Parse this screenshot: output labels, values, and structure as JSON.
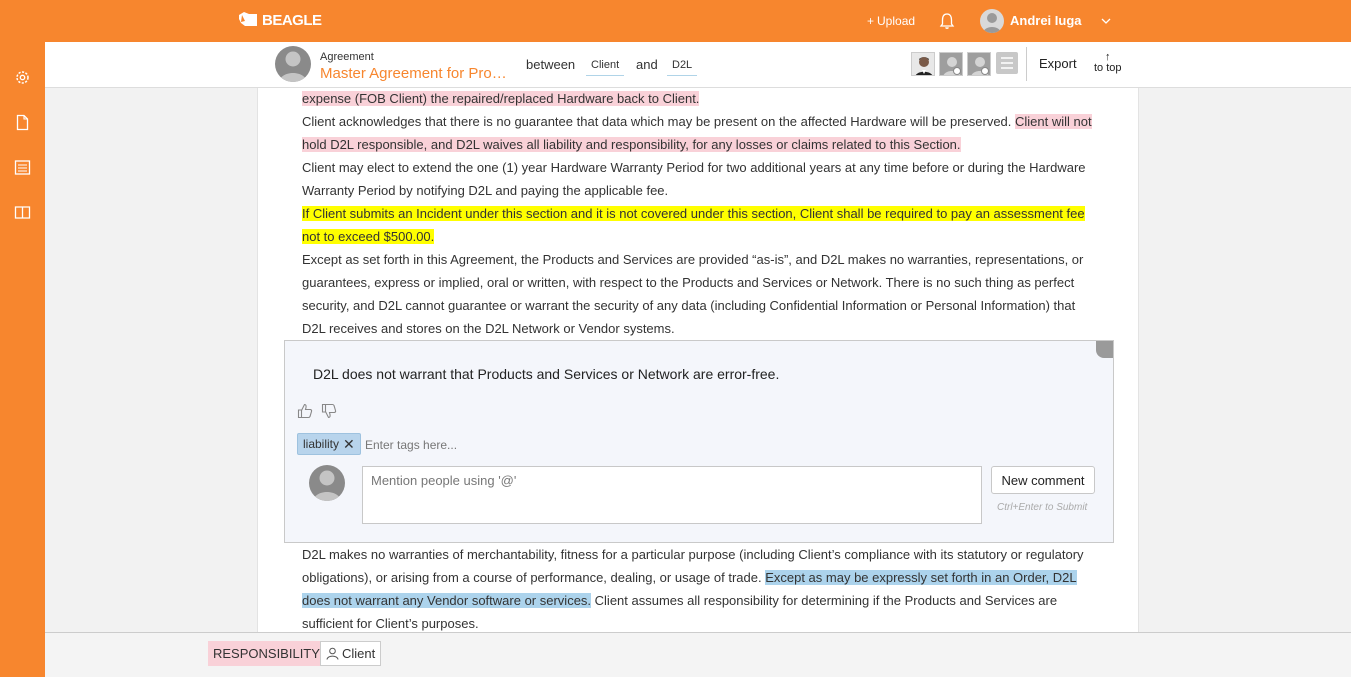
{
  "app": {
    "name": "BEAGLE"
  },
  "topbar": {
    "upload_label": "Upload",
    "user_name": "Andrei Iuga",
    "icons": [
      "plus-icon",
      "bell-icon",
      "avatar",
      "caret-down-icon"
    ]
  },
  "sidebar": {
    "items": [
      {
        "icon": "gear-icon"
      },
      {
        "icon": "document-icon"
      },
      {
        "icon": "list-icon"
      },
      {
        "icon": "book-icon"
      }
    ]
  },
  "header": {
    "doc_type": "Agreement",
    "doc_title": "Master Agreement for Products and Services",
    "between_label": "between",
    "party_a": "Client",
    "and_label": "and",
    "party_b": "D2L",
    "export_label": "Export",
    "to_top_label": "to top",
    "to_top_arrow": "↑"
  },
  "document": {
    "p1": {
      "highlight": "expense (FOB Client) the repaired/replaced Hardware back to Client."
    },
    "p2": {
      "text": " Client acknowledges that there is no guarantee that data which may be present on the affected Hardware will be preserved. ",
      "highlight": "Client will not hold D2L responsible, and D2L waives all liability and responsibility, for any losses or claims related to this Section."
    },
    "p3": {
      "text": " Client may elect to extend the one (1) year Hardware Warranty Period for two additional years at any time before or during the Hardware Warranty Period by notifying D2L and paying the applicable fee."
    },
    "p4": {
      "highlight": " If Client submits an Incident under this section and it is not covered under this section, Client shall be required to pay an assessment fee not to exceed $500.00."
    },
    "p5": {
      "text": " Except as set forth in this Agreement, the Products and Services are provided “as-is”, and D2L makes no warranties, representations, or guarantees, express or implied, oral or written, with respect to the Products and Services or Network.  There is no such thing as perfect security, and D2L cannot guarantee or warrant the security of any data (including Confidential Information or Personal Information) that D2L receives and stores on the D2L Network or Vendor systems."
    },
    "p6": {
      "text_before": " D2L makes no warranties of merchantability, fitness for a particular purpose (including Client’s compliance with its statutory or regulatory obligations), or arising from a course of performance, dealing, or usage of trade. ",
      "highlight": "Except as may be expressly set forth in an Order, D2L does not warrant any Vendor software or services.",
      "text_after": " Client assumes all responsibility for determining if the Products and Services are sufficient for Client’s purposes."
    }
  },
  "comment_panel": {
    "clause_text": "D2L does not warrant that Products and Services or Network are error-free.",
    "tag": "liability",
    "tag_remove": "✕",
    "tags_placeholder": "Enter tags here...",
    "comment_placeholder": "Mention people using '@'",
    "new_comment_label": "New comment",
    "submit_hint": "Ctrl+Enter to Submit"
  },
  "bottombar": {
    "category_badge": "RESPONSIBILITY",
    "party_badge": "Client"
  },
  "colors": {
    "brand": "#f7862e",
    "highlight_pink": "#f9d1d8",
    "highlight_yellow": "#ffff00",
    "highlight_blue": "#acd3ec"
  }
}
